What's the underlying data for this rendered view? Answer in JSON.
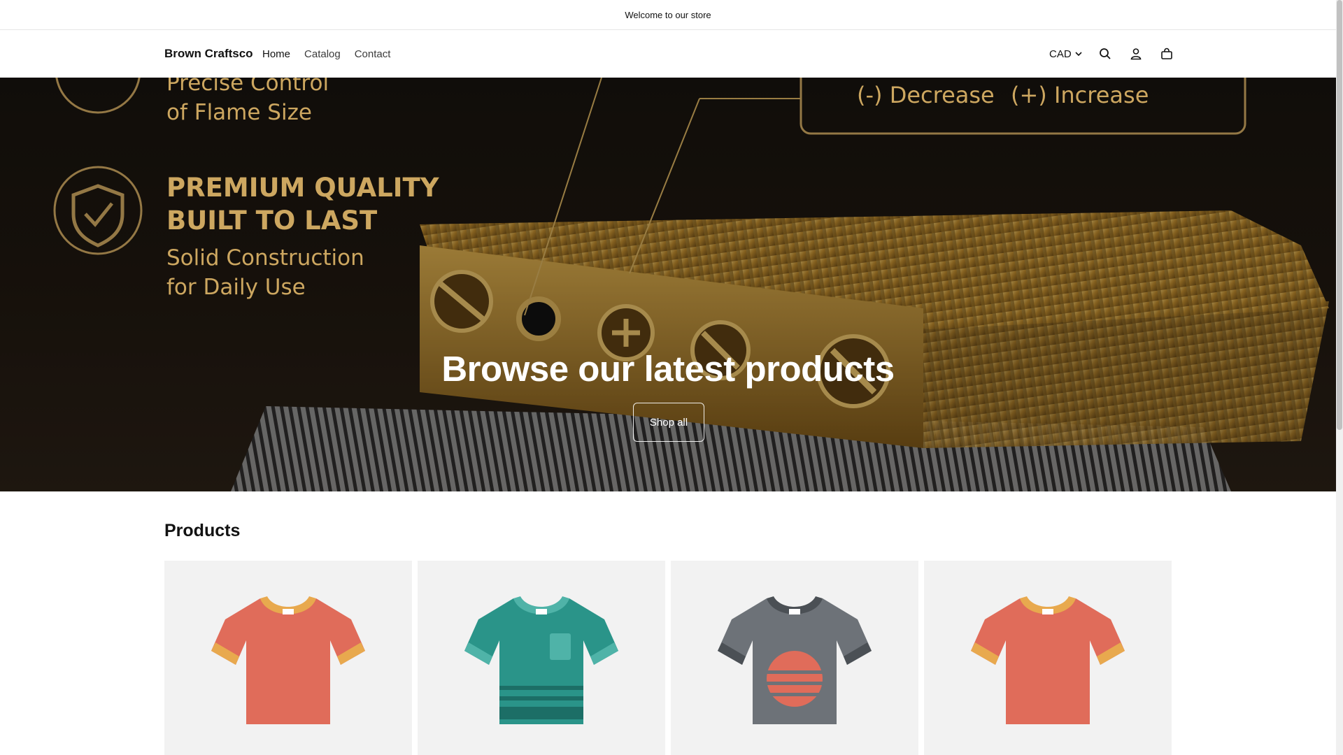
{
  "announcement": {
    "text": "Welcome to our store"
  },
  "header": {
    "brand": "Brown Craftsco",
    "nav": [
      "Home",
      "Catalog",
      "Contact"
    ],
    "currency": "CAD",
    "icons": [
      "search-icon",
      "account-icon",
      "cart-icon"
    ]
  },
  "hero": {
    "title": "Browse our latest products",
    "button_label": "Shop all",
    "image_text": {
      "line1": "Precise Control",
      "line2": "of Flame Size",
      "heading1": "PREMIUM QUALITY",
      "heading2": "BUILT TO LAST",
      "sub1": "Solid Construction",
      "sub2": "for Daily Use",
      "decrease": "(-) Decrease",
      "increase": "(+) Increase"
    }
  },
  "products": {
    "title": "Products",
    "items": [
      {
        "shirt_color": "#e06c5a",
        "trim_color": "#e8a94e"
      },
      {
        "shirt_color": "#2a9489",
        "trim_color": "#4fb3a8"
      },
      {
        "shirt_color": "#6d7278",
        "trim_color": "#4b5055"
      },
      {
        "shirt_color": "#e06c5a",
        "trim_color": "#e8a94e"
      }
    ]
  },
  "colors": {
    "accent_gold": "#cda760",
    "text": "#121212"
  }
}
